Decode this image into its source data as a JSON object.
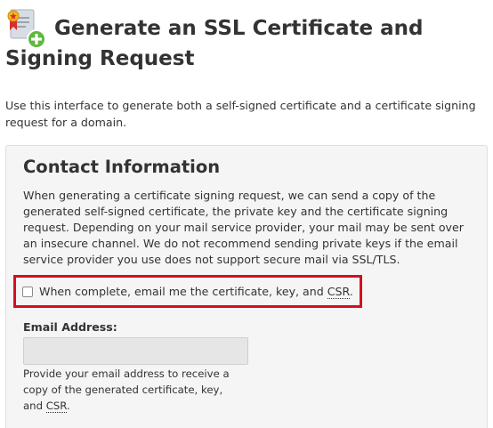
{
  "page": {
    "title": "Generate an SSL Certificate and Signing Request",
    "icon": "ssl-certificate-add-icon",
    "intro": "Use this interface to generate both a self-signed certificate and a certificate signing request for a domain."
  },
  "contact_panel": {
    "heading": "Contact Information",
    "description": "When generating a certificate signing request, we can send a copy of the generated self-signed certificate, the private key and the certificate signing request. Depending on your mail service provider, your mail may be sent over an insecure channel. We do not recommend sending private keys if the email service provider you use does not support secure mail via SSL/TLS.",
    "email_checkbox": {
      "label_prefix": "When complete, email me the certificate, key, and ",
      "label_abbr": "CSR",
      "label_suffix": ".",
      "checked": false
    },
    "email_field": {
      "label": "Email Address:",
      "value": "",
      "help_prefix": "Provide your email address to receive a copy of the generated certificate, key, and ",
      "help_abbr": "CSR",
      "help_suffix": "."
    }
  },
  "colors": {
    "highlight": "#d3101e",
    "panel_background": "#f5f5f5",
    "text": "#333333"
  }
}
